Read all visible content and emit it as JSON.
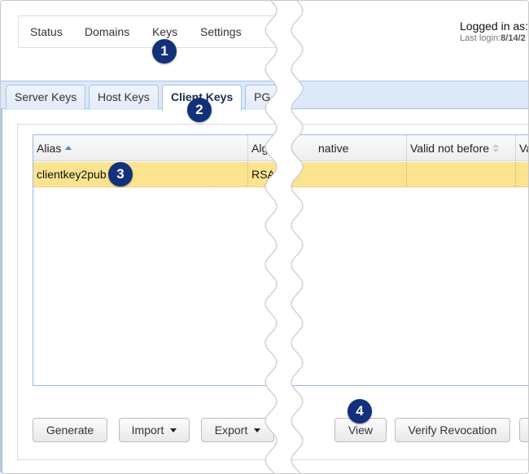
{
  "topnav": {
    "items": [
      {
        "label": "Status"
      },
      {
        "label": "Domains"
      },
      {
        "label": "Keys"
      },
      {
        "label": "Settings"
      }
    ]
  },
  "login": {
    "logged_in_label": "Logged in as:",
    "last_login_label": "Last login:",
    "last_login_value": "8/14/2"
  },
  "tabs": [
    {
      "label": "Server Keys",
      "active": false
    },
    {
      "label": "Host Keys",
      "active": false
    },
    {
      "label": "Client Keys",
      "active": true
    },
    {
      "label": "PG",
      "active": false
    }
  ],
  "grid": {
    "columns": [
      {
        "label": "Alias",
        "sort": "ascending"
      },
      {
        "label": "Alg",
        "sort": "none"
      },
      {
        "label": "native",
        "sort": "none"
      },
      {
        "label": "Valid not before",
        "sort": "sortable"
      },
      {
        "label": "Va",
        "sort": "none"
      }
    ],
    "rows": [
      {
        "alias": "clientkey2pub",
        "algorithm": "RSA",
        "alternative": "",
        "valid_not_before": "",
        "valid_to": "",
        "selected": true
      }
    ]
  },
  "buttons": {
    "generate": "Generate",
    "import": "Import",
    "export": "Export",
    "view": "View",
    "verify_revocation": "Verify Revocation"
  },
  "callouts": [
    "1",
    "2",
    "3",
    "4"
  ],
  "colors": {
    "callout": "#13307a",
    "selected_row": "#fce390",
    "tabbar": "#dde9f8",
    "accent_border": "#a9c4e4"
  }
}
